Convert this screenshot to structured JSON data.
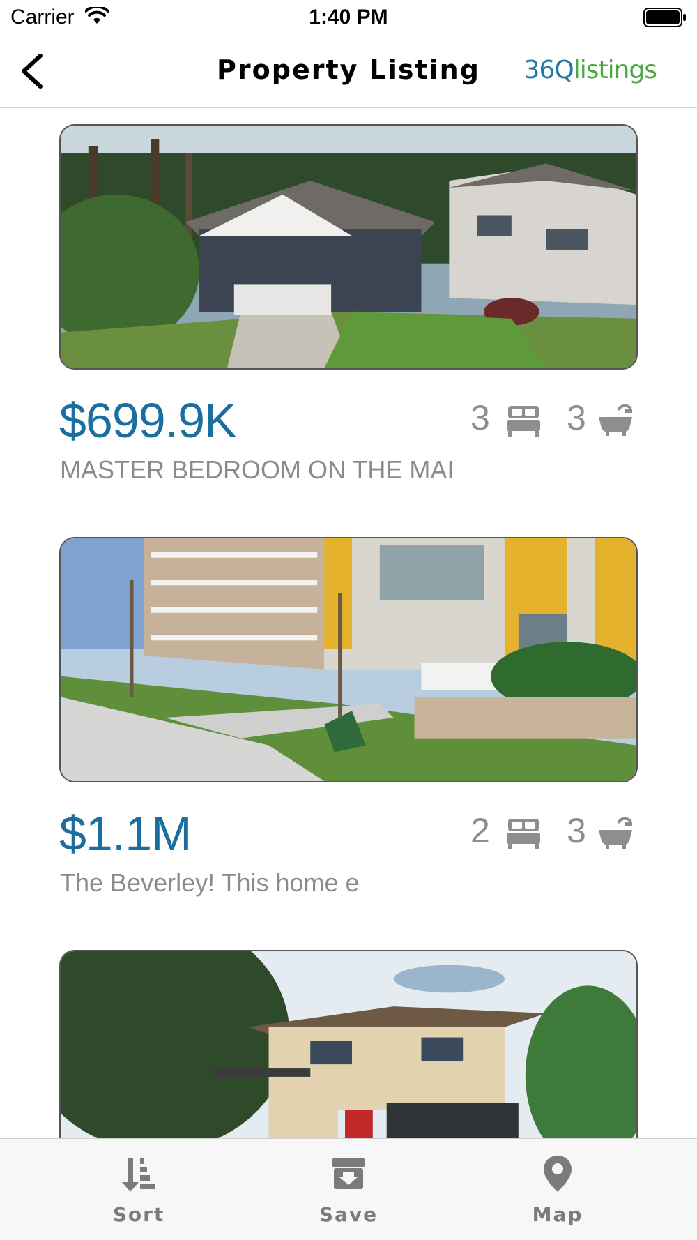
{
  "status_bar": {
    "carrier": "Carrier",
    "time": "1:40 PM"
  },
  "nav": {
    "title": "Property Listing",
    "logo_number": "36",
    "logo_letter": "Q",
    "logo_word": "listings"
  },
  "listings": [
    {
      "price": "$699.9K",
      "description": "MASTER BEDROOM ON THE MAI",
      "beds": "3",
      "baths": "3"
    },
    {
      "price": "$1.1M",
      "description": "The Beverley! This home e",
      "beds": "2",
      "baths": "3"
    },
    {
      "price": "",
      "description": "",
      "beds": "",
      "baths": ""
    }
  ],
  "tabs": [
    {
      "label": "Sort",
      "icon": "sort-icon"
    },
    {
      "label": "Save",
      "icon": "save-icon"
    },
    {
      "label": "Map",
      "icon": "map-pin-icon"
    }
  ],
  "colors": {
    "price": "#1a6fa0",
    "muted_text": "#8b8b8b",
    "tab_icon": "#7b7b7b",
    "logo_blue": "#1f78a8",
    "logo_green": "#4aa83e"
  }
}
